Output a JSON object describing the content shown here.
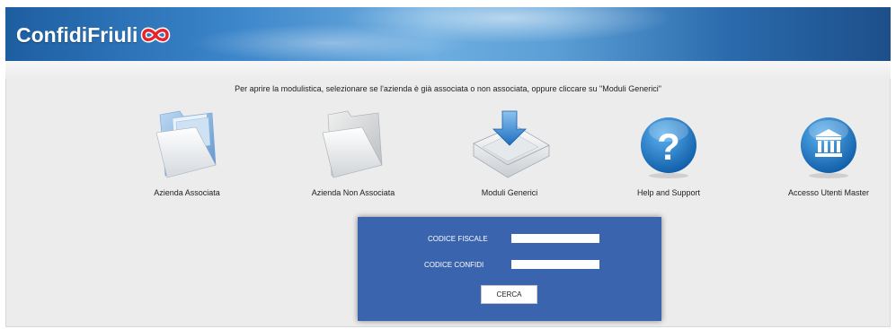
{
  "header": {
    "brand_name": "ConfidiFriuli",
    "logo_icon": "confidi-infinity-logo-icon",
    "accent_color": "#e5242c"
  },
  "main": {
    "instructions": "Per aprire la modulistica, selezionare se l'azienda è già associata o non associata, oppure cliccare su \"Moduli Generici\"",
    "options": [
      {
        "label": "Azienda Associata",
        "icon": "blue-folder-icon"
      },
      {
        "label": "Azienda Non Associata",
        "icon": "grey-folder-icon"
      },
      {
        "label": "Moduli Generici",
        "icon": "download-tray-icon"
      },
      {
        "label": "Help and Support",
        "icon": "question-mark-icon"
      },
      {
        "label": "Accesso Utenti Master",
        "icon": "bank-building-icon"
      }
    ]
  },
  "login": {
    "codice_fiscale_label": "CODICE FISCALE",
    "codice_fiscale_value": "",
    "codice_confidi_label": "CODICE CONFIDI",
    "codice_confidi_value": "",
    "search_button": "CERCA",
    "panel_color": "#3b64ae"
  }
}
